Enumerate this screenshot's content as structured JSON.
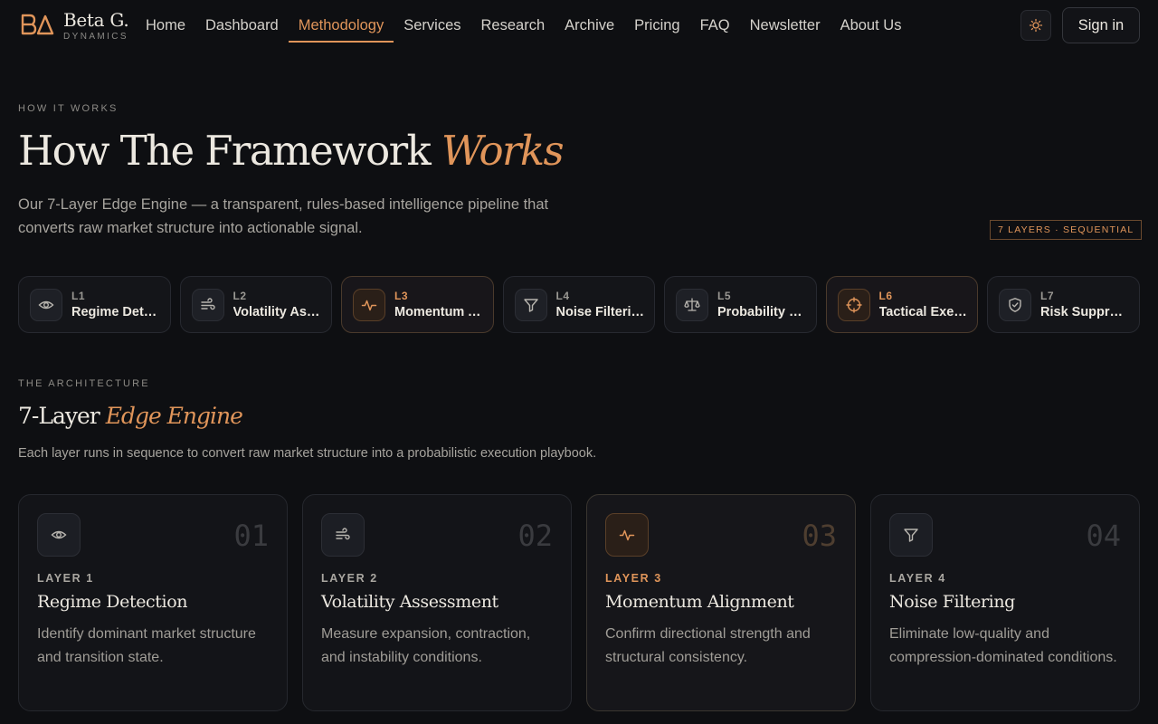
{
  "brand": {
    "name": "Beta G.",
    "sub": "DYNAMICS",
    "accent": "#e0955a"
  },
  "nav": {
    "links": [
      "Home",
      "Dashboard",
      "Methodology",
      "Services",
      "Research",
      "Archive",
      "Pricing",
      "FAQ",
      "Newsletter",
      "About Us"
    ],
    "active": "Methodology",
    "theme_icon": "sun-icon",
    "signin": "Sign in"
  },
  "hero": {
    "eyebrow": "HOW IT WORKS",
    "title_main": "How The Framework",
    "title_accent": "Works",
    "description": "Our 7-Layer Edge Engine — a transparent, rules-based intelligence pipeline that converts raw market structure into actionable signal.",
    "badge": "7 LAYERS · SEQUENTIAL"
  },
  "pills": [
    {
      "num": "L1",
      "name": "Regime Detection",
      "icon": "eye-icon"
    },
    {
      "num": "L2",
      "name": "Volatility Assessment",
      "icon": "wind-icon"
    },
    {
      "num": "L3",
      "name": "Momentum Alignment",
      "icon": "pulse-icon"
    },
    {
      "num": "L4",
      "name": "Noise Filtering",
      "icon": "filter-icon"
    },
    {
      "num": "L5",
      "name": "Probability Scoring",
      "icon": "scale-icon"
    },
    {
      "num": "L6",
      "name": "Tactical Execution",
      "icon": "crosshair-icon"
    },
    {
      "num": "L7",
      "name": "Risk Suppression",
      "icon": "shield-icon"
    }
  ],
  "architecture": {
    "eyebrow": "THE ARCHITECTURE",
    "title_main": "7-Layer",
    "title_accent": "Edge Engine",
    "description": "Each layer runs in sequence to convert raw market structure into a probabilistic execution playbook."
  },
  "cards": [
    {
      "num": "01",
      "layer": "LAYER 1",
      "title": "Regime Detection",
      "desc": "Identify dominant market structure and transition state.",
      "icon": "eye-icon"
    },
    {
      "num": "02",
      "layer": "LAYER 2",
      "title": "Volatility Assessment",
      "desc": "Measure expansion, contraction, and instability conditions.",
      "icon": "wind-icon"
    },
    {
      "num": "03",
      "layer": "LAYER 3",
      "title": "Momentum Alignment",
      "desc": "Confirm directional strength and structural consistency.",
      "icon": "pulse-icon"
    },
    {
      "num": "04",
      "layer": "LAYER 4",
      "title": "Noise Filtering",
      "desc": "Eliminate low-quality and compression-dominated conditions.",
      "icon": "filter-icon"
    }
  ]
}
